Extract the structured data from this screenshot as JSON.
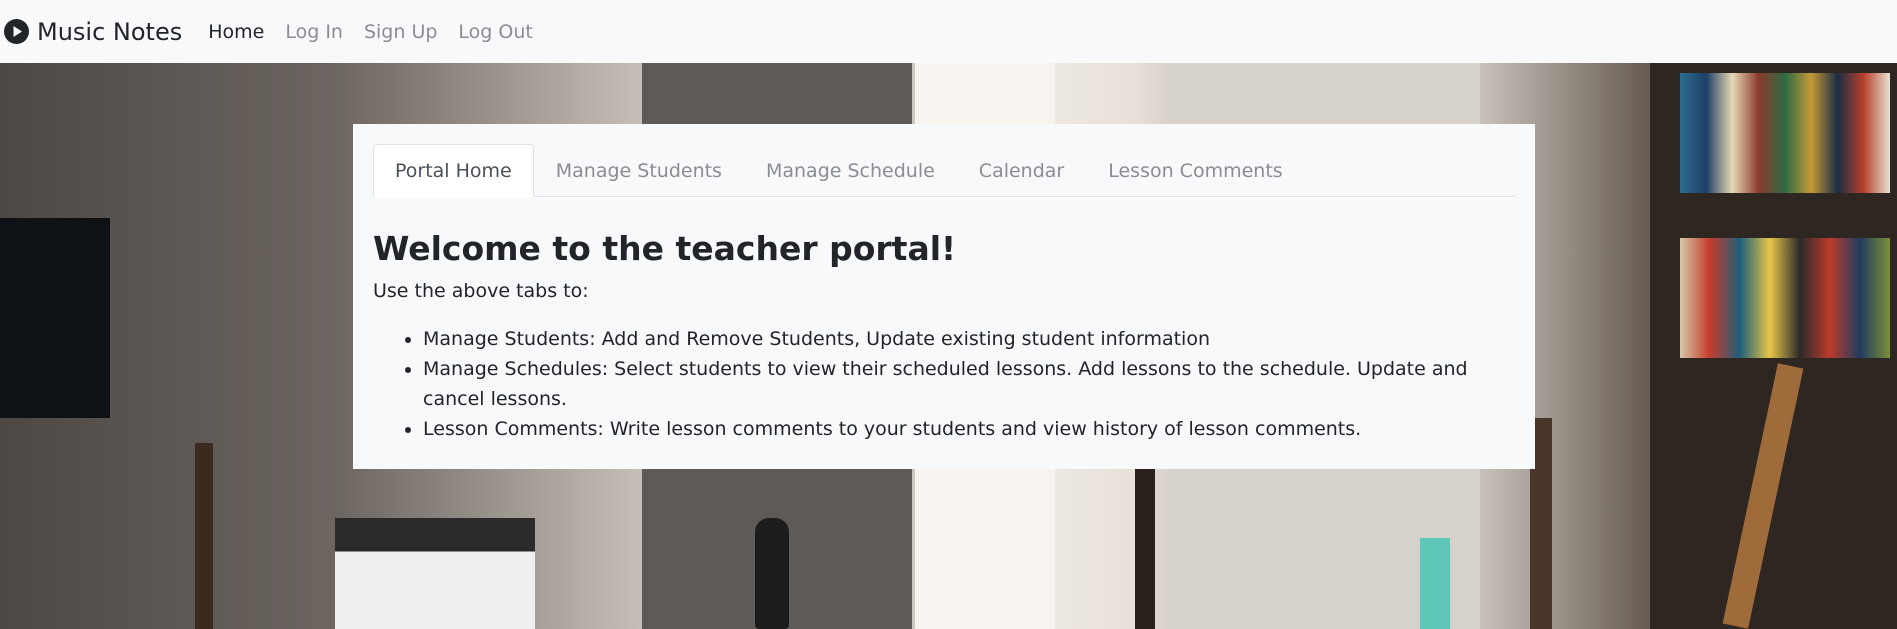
{
  "navbar": {
    "brand": "Music Notes",
    "brand_icon": "play-circle-icon",
    "links": [
      "Home",
      "Log In",
      "Sign Up",
      "Log Out"
    ]
  },
  "portal": {
    "tabs": [
      "Portal Home",
      "Manage Students",
      "Manage Schedule",
      "Calendar",
      "Lesson Comments"
    ],
    "heading": "Welcome to the teacher portal!",
    "intro": "Use the above tabs to:",
    "bullets": [
      "Manage Students: Add and Remove Students, Update existing student information",
      "Manage Schedules: Select students to view their scheduled lessons. Add lessons to the schedule. Update and cancel lessons.",
      "Lesson Comments: Write lesson comments to your students and view history of lesson comments."
    ]
  },
  "colors": {
    "navbar_bg": "#f8f9fa",
    "text": "#212529",
    "muted": "#8a8d91"
  }
}
